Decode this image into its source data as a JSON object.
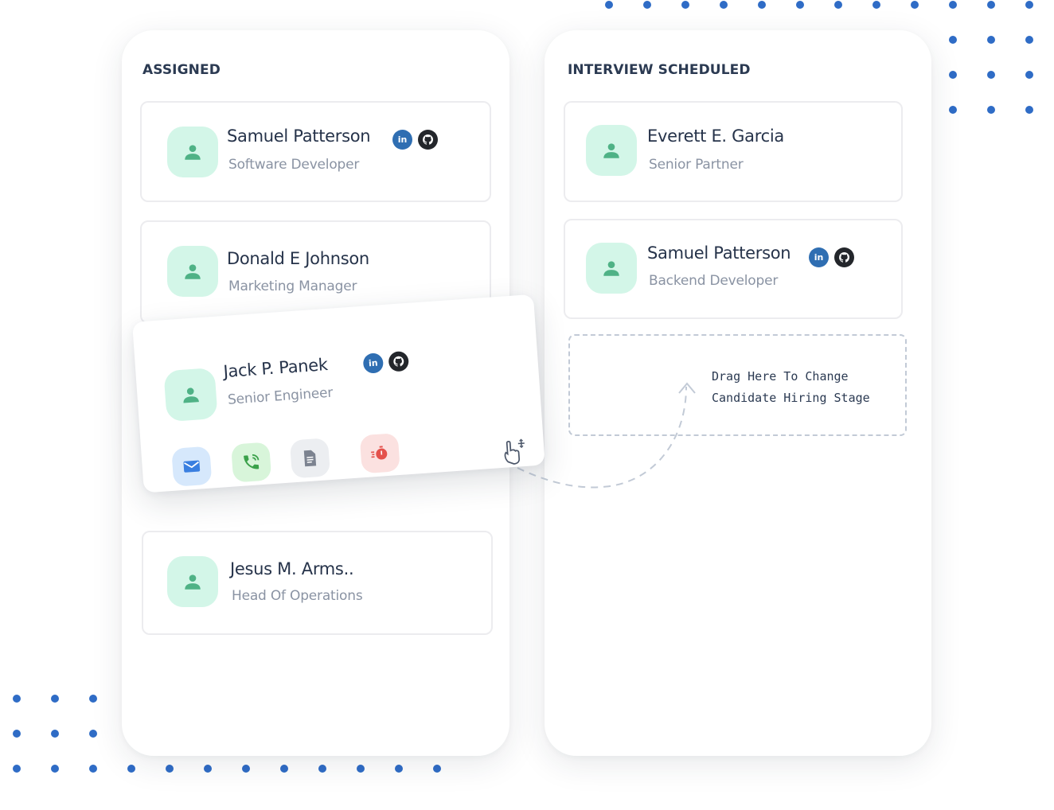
{
  "columns": [
    {
      "title": "ASSIGNED",
      "cards": [
        {
          "name": "Samuel Patterson",
          "role": "Software Developer",
          "social": [
            "linkedin",
            "github"
          ]
        },
        {
          "name": "Donald E Johnson",
          "role": "Marketing Manager",
          "social": []
        },
        {
          "name": "Jesus M. Arms..",
          "role": "Head Of Operations",
          "social": []
        }
      ]
    },
    {
      "title": "INTERVIEW SCHEDULED",
      "cards": [
        {
          "name": "Everett E. Garcia",
          "role": "Senior Partner",
          "social": []
        },
        {
          "name": "Samuel Patterson",
          "role": "Backend Developer",
          "social": [
            "linkedin",
            "github"
          ]
        }
      ],
      "drop_zone_text": "Drag Here To Change\nCandidate Hiring Stage"
    }
  ],
  "dragged_card": {
    "name": "Jack P. Panek",
    "role": "Senior Engineer",
    "social": [
      "linkedin",
      "github"
    ],
    "actions": [
      {
        "icon": "mail-icon",
        "color": "#3a7fe0",
        "bg": "#d6e8fc"
      },
      {
        "icon": "phone-call-icon",
        "color": "#3aa14a",
        "bg": "#d8f5da"
      },
      {
        "icon": "document-icon",
        "color": "#7c8390",
        "bg": "#eceef1"
      },
      {
        "icon": "timer-icon",
        "color": "#e4514b",
        "bg": "#fbe1e0"
      }
    ],
    "cursor_icon": "drag-hand-icon"
  },
  "social_labels": {
    "linkedin": "in"
  },
  "colors": {
    "accent_dots": "#2f6cc6",
    "avatar_bg": "#d3f6e8",
    "avatar_fg": "#4fb286",
    "linkedin": "#2f6eb2",
    "github": "#23262b"
  }
}
